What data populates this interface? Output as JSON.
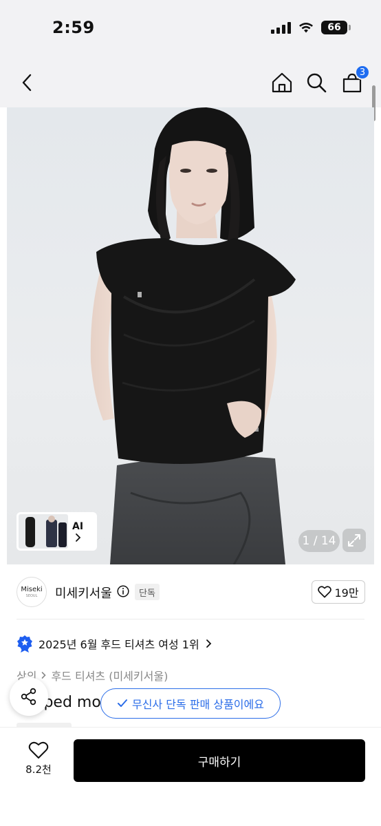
{
  "status_bar": {
    "time": "2:59",
    "battery": "66"
  },
  "nav": {
    "back_icon": "chevron-left-icon",
    "home_icon": "home-icon",
    "search_icon": "search-icon",
    "cart_icon": "shopping-bag-icon",
    "cart_count": "3",
    "badge_color": "#1e6cf0"
  },
  "gallery": {
    "ai_label": "AI",
    "counter": "1 / 14",
    "expand_icon": "expand-icon"
  },
  "brand": {
    "logo_text": "Miseki",
    "logo_subtext": "SEOUL",
    "name": "미세키서울",
    "info_icon": "info-icon",
    "exclusive_tag": "단독",
    "likes": "19만",
    "like_icon": "heart-icon"
  },
  "ranking": {
    "badge_icon": "star-badge-icon",
    "text": "2025년 6월 후드 티셔츠 여성 1위",
    "arrow_icon": "chevron-right-icon"
  },
  "breadcrumb": {
    "category": "상의",
    "subcategory": "후드 티셔츠 (미세키서울)"
  },
  "product": {
    "title_peek": "Draped mo"
  },
  "toast": {
    "text": "무신사 단독 판매 상품이에요",
    "icon": "check-icon",
    "color": "#2b6de8"
  },
  "share": {
    "icon": "share-icon"
  },
  "bottom_bar": {
    "wish_count": "8.2천",
    "buy_label": "구매하기"
  }
}
